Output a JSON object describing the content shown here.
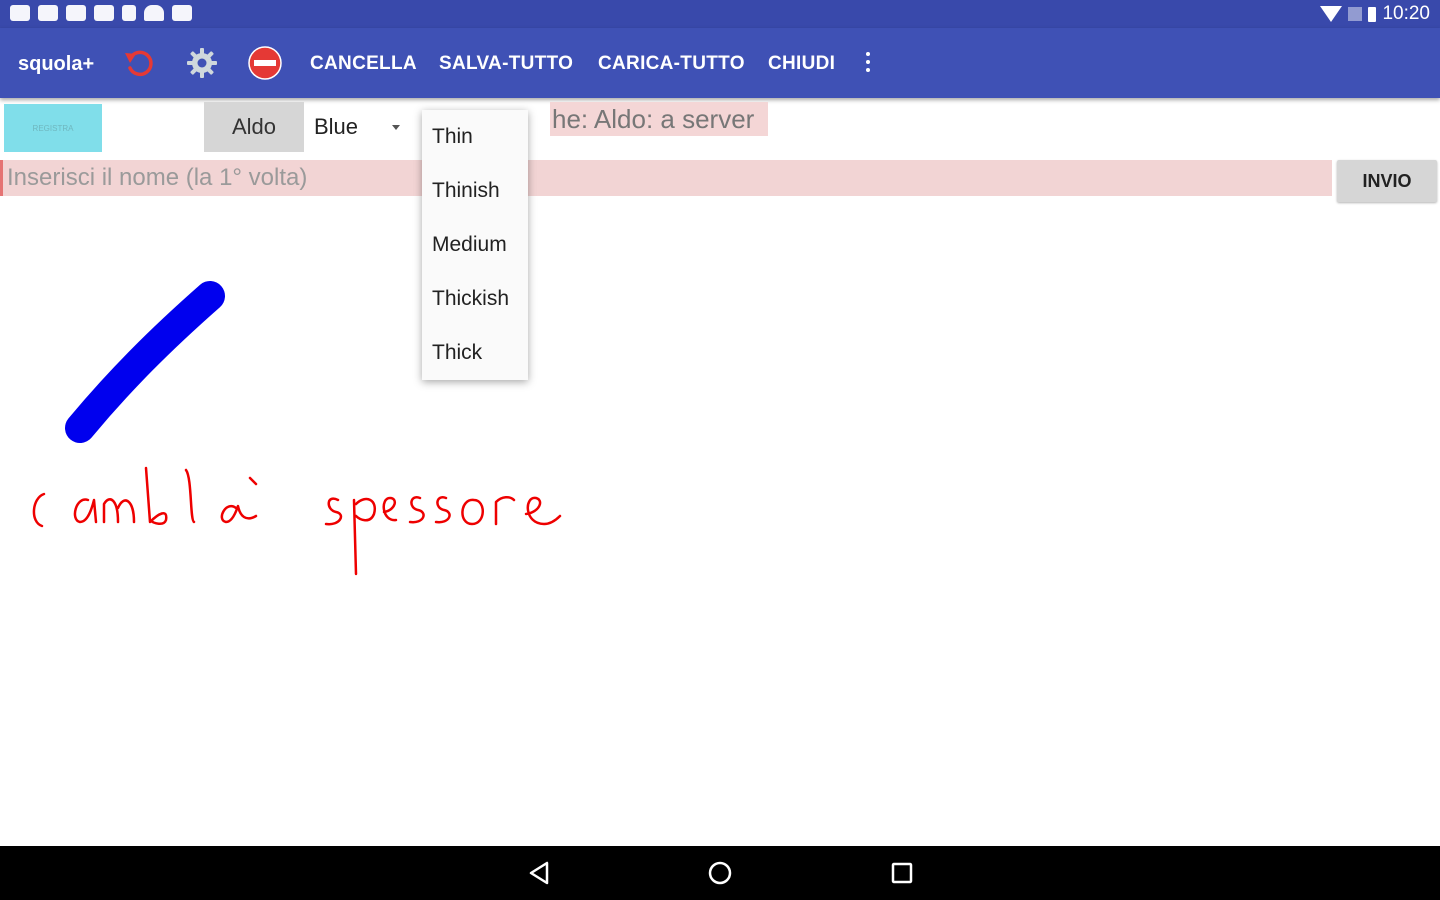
{
  "status_bar": {
    "time": "10:20",
    "notification_icons": [
      "notification-icon",
      "notification-icon",
      "image-icon",
      "download-icon",
      "sd-card-icon",
      "cloud-icon",
      "image-icon"
    ],
    "system_icons": [
      "wifi-icon",
      "signal-icon",
      "battery-icon"
    ]
  },
  "toolbar": {
    "app_title": "squola+",
    "icons": [
      "undo-icon",
      "gear-icon",
      "no-entry-icon"
    ],
    "actions": {
      "cancel": "CANCELLA",
      "save_all": "SALVA-TUTTO",
      "load_all": "CARICA-TUTTO",
      "close": "CHIUDI"
    }
  },
  "controls": {
    "register_button": "REGISTRA",
    "name_button": "Aldo",
    "color_spinner": {
      "selected": "Blue"
    },
    "server_message": "he: Aldo: a server"
  },
  "name_input": {
    "placeholder": "Inserisci il nome (la 1° volta)",
    "value": ""
  },
  "send_button": "INVIO",
  "thickness_dropdown": {
    "options": [
      "Thin",
      "Thinish",
      "Medium",
      "Thickish",
      "Thick"
    ]
  },
  "canvas": {
    "colors": {
      "blue_stroke": "#0000ee",
      "red_stroke": "#ee0000"
    },
    "handwriting": "cambia spessore"
  },
  "navbar": {
    "icons": [
      "back-icon",
      "home-icon",
      "recents-icon"
    ]
  },
  "colors": {
    "status_bar": "#3949ab",
    "toolbar": "#3f51b5",
    "accent_register": "#80deea",
    "input_background": "#f2d4d4"
  }
}
